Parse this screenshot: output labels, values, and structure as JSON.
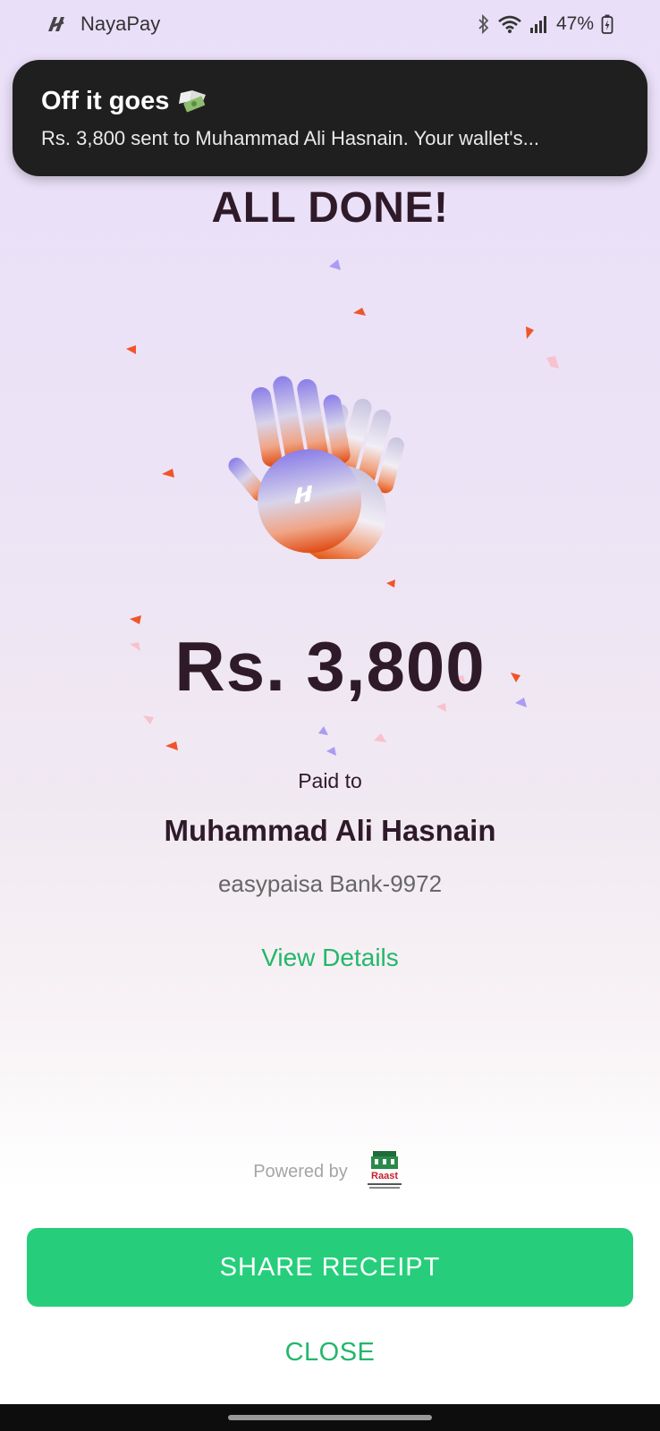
{
  "status_bar": {
    "app_name": "NayaPay",
    "battery": "47%"
  },
  "notification": {
    "title": "Off it goes",
    "title_emoji": "money-with-wings-icon",
    "body": "Rs. 3,800 sent to Muhammad Ali Hasnain. Your wallet's..."
  },
  "main": {
    "headline": "ALL DONE!",
    "amount": "Rs. 3,800",
    "paid_to_label": "Paid to",
    "payee_name": "Muhammad Ali Hasnain",
    "payee_bank": "easypaisa Bank-9972",
    "view_details": "View Details"
  },
  "footer": {
    "powered_by": "Powered by",
    "raast_label": "Raast"
  },
  "actions": {
    "share_receipt": "SHARE RECEIPT",
    "close": "CLOSE"
  },
  "colors": {
    "accent_green": "#26ce7b",
    "text_dark": "#2f1a2a",
    "confetti_orange": "#f0552a",
    "confetti_purple": "#a99cf2",
    "confetti_pink": "#f7c2cc"
  }
}
